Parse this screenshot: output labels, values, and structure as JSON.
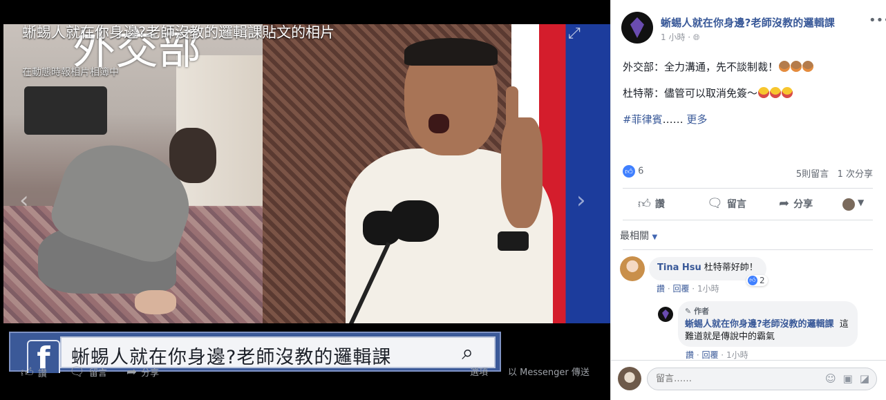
{
  "viewer": {
    "title": "蜥蜴人就在你身邊?老師沒教的邏輯課貼文的相片",
    "subtitle": "在動態時報相片相簿中",
    "photo_overlay_text": "外交部",
    "banner": {
      "logo": "f",
      "search_text": "蜥蜴人就在你身邊?老師沒教的邏輯課"
    },
    "actions": {
      "like": "讚",
      "comment": "留言",
      "share": "分享",
      "options": "選項",
      "send_messenger": "以 Messenger 傳送"
    }
  },
  "post": {
    "page_name": "蜥蜴人就在你身邊?老師沒教的邏輯課",
    "time": "1 小時",
    "line1": "外交部：全力溝通，先不談制裁！",
    "line2": "杜特蒂：儘管可以取消免簽～",
    "hashtag": "#菲律賓",
    "ellipsis": "……",
    "more": "更多",
    "like_count": "6",
    "comment_count": "5則留言",
    "share_count": "1 次分享",
    "actions": {
      "like": "讚",
      "comment": "留言",
      "share": "分享"
    },
    "sort_label": "最相關"
  },
  "comments": [
    {
      "author": "Tina Hsu",
      "text": "杜特蒂好帥！",
      "reactions": "2",
      "like": "讚",
      "reply": "回覆",
      "time": "1小時"
    },
    {
      "badge": "作者",
      "author": "蜥蜴人就在你身邊?老師沒教的邏輯課",
      "text": "這難道就是傳說中的霸氣",
      "like": "讚",
      "reply": "回覆",
      "time": "1小時"
    }
  ],
  "compose": {
    "placeholder": "留言……"
  },
  "colors": {
    "link": "#385898",
    "facebook_blue": "#3b5998",
    "like_blue": "#4080ff"
  }
}
